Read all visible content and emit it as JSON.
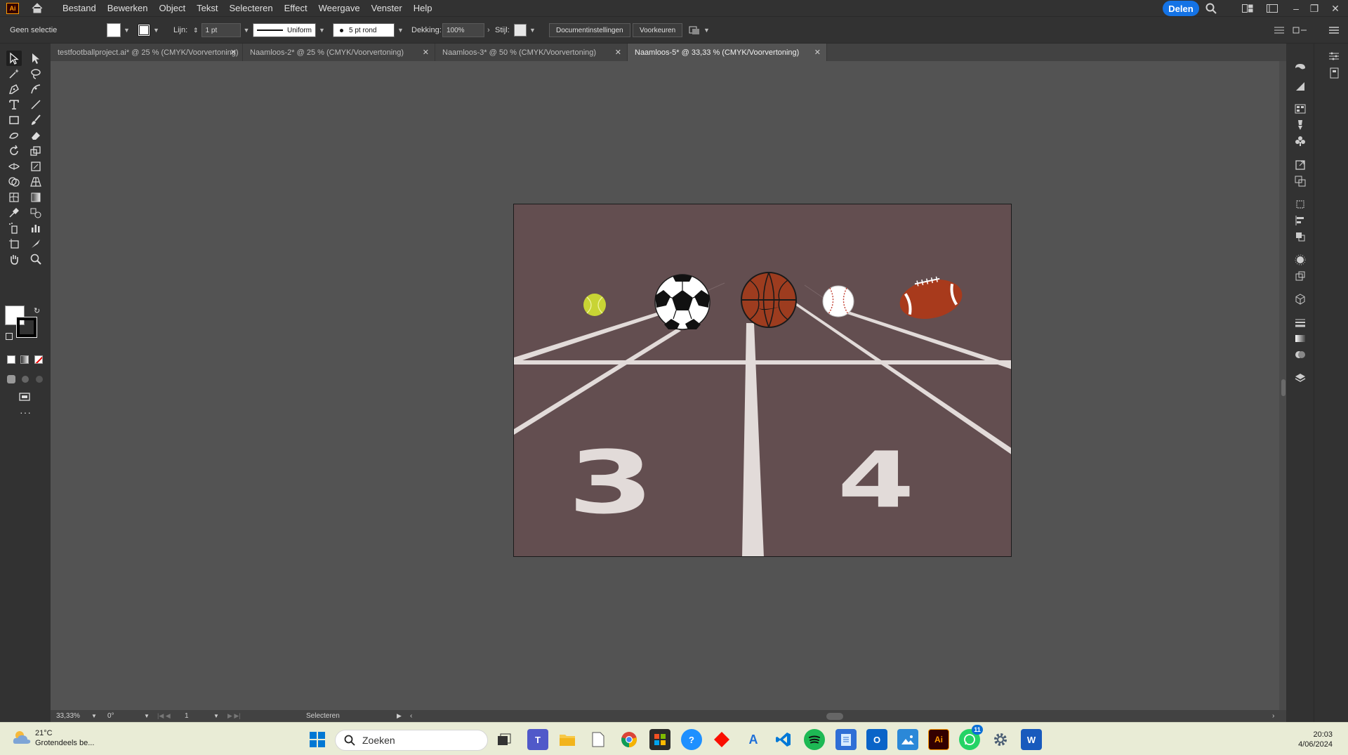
{
  "menubar": {
    "items": [
      "Bestand",
      "Bewerken",
      "Object",
      "Tekst",
      "Selecteren",
      "Effect",
      "Weergave",
      "Venster",
      "Help"
    ],
    "share_label": "Delen"
  },
  "controlbar": {
    "selection": "Geen selectie",
    "stroke_label": "Lijn:",
    "stroke_weight": "1 pt",
    "stroke_profile": "Uniform",
    "brush": "5 pt rond",
    "opacity_label": "Dekking:",
    "opacity_value": "100%",
    "style_label": "Stijl:",
    "doc_settings": "Documentinstellingen",
    "preferences": "Voorkeuren"
  },
  "tabs": [
    {
      "label": "testfootballproject.ai* @ 25 % (CMYK/Voorvertoning)",
      "active": false
    },
    {
      "label": "Naamloos-2* @ 25 % (CMYK/Voorvertoning)",
      "active": false
    },
    {
      "label": "Naamloos-3* @ 50 % (CMYK/Voorvertoning)",
      "active": false
    },
    {
      "label": "Naamloos-5* @ 33,33 % (CMYK/Voorvertoning)",
      "active": true
    }
  ],
  "artwork": {
    "background_color": "#634e50",
    "lane_numbers": [
      "3",
      "4"
    ]
  },
  "statusbar": {
    "zoom": "33,33%",
    "rotation": "0°",
    "artboard_index": "1",
    "tool_status": "Selecteren"
  },
  "taskbar": {
    "temperature": "21°C",
    "weather_text": "Grotendeels be...",
    "search_placeholder": "Zoeken",
    "time": "20:03",
    "date": "4/06/2024",
    "whatsapp_badge": "11"
  }
}
